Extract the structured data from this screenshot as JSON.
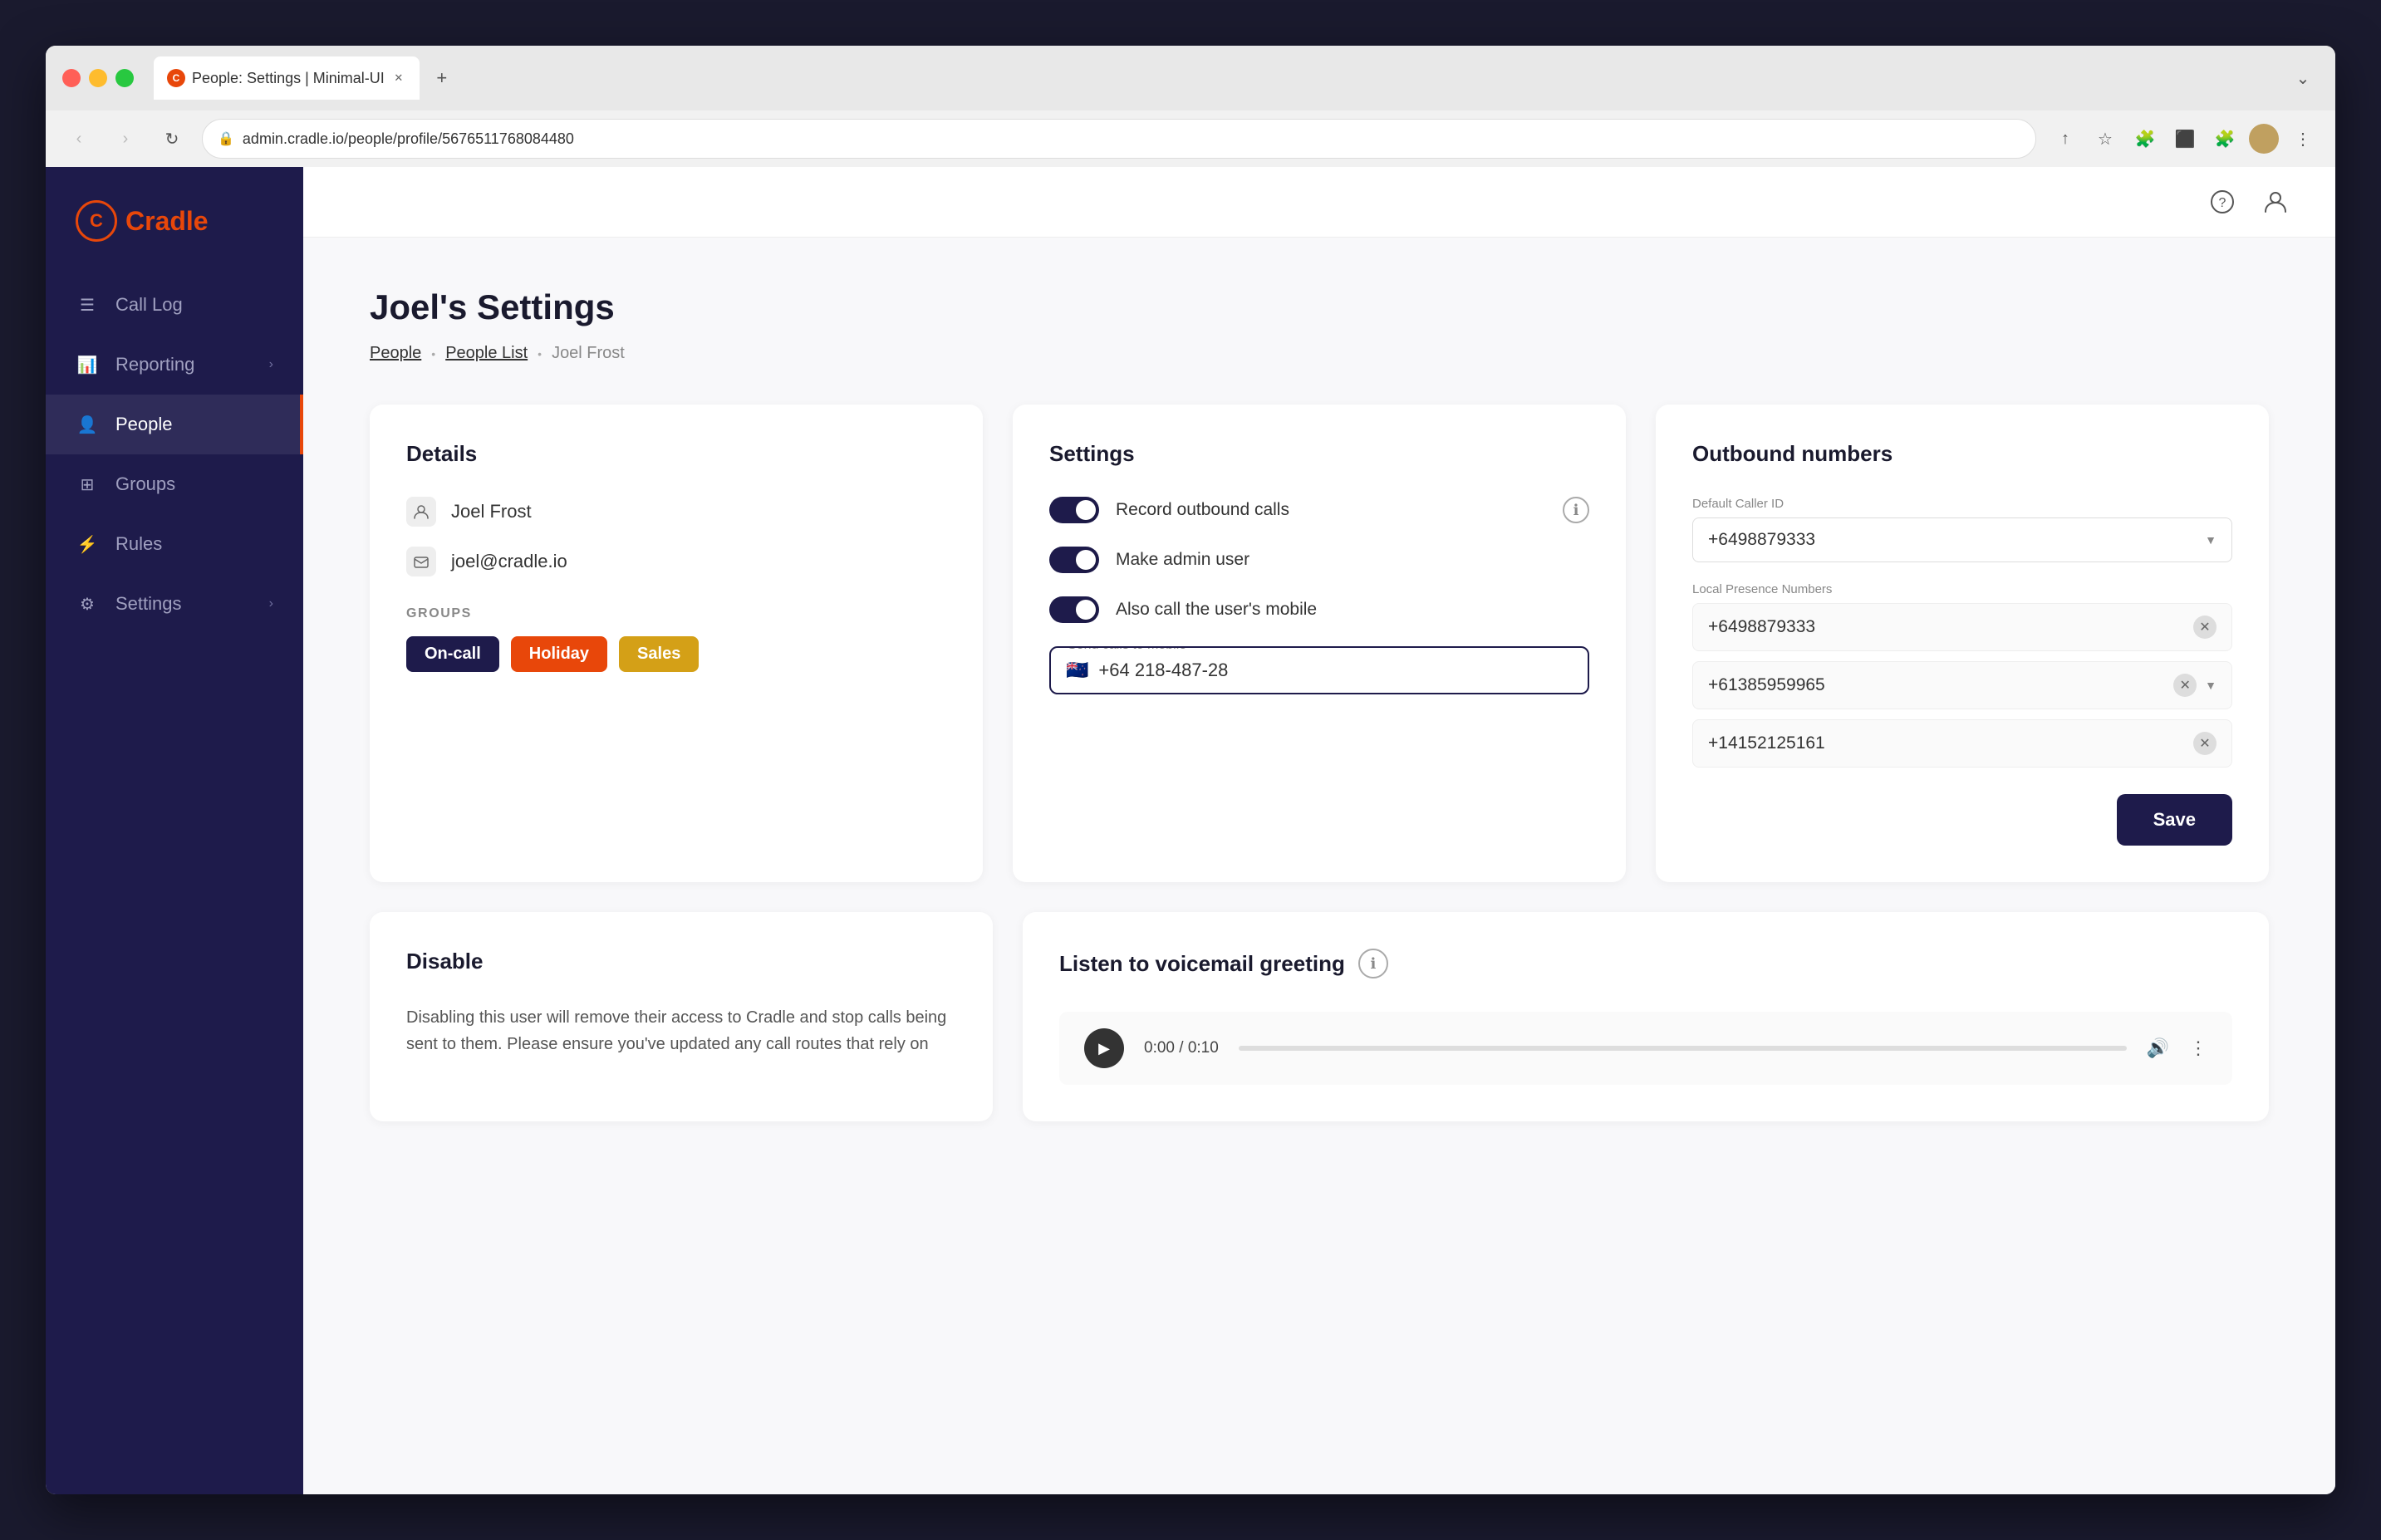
{
  "browser": {
    "tab_title": "People: Settings | Minimal-UI",
    "tab_favicon_letter": "C",
    "url": "admin.cradle.io/people/profile/5676511768084480",
    "new_tab_label": "+"
  },
  "app": {
    "logo_text": "Cradle",
    "logo_letter": "C"
  },
  "sidebar": {
    "items": [
      {
        "id": "call-log",
        "label": "Call Log",
        "has_arrow": false
      },
      {
        "id": "reporting",
        "label": "Reporting",
        "has_arrow": true
      },
      {
        "id": "people",
        "label": "People",
        "has_arrow": false,
        "active": true
      },
      {
        "id": "groups",
        "label": "Groups",
        "has_arrow": false
      },
      {
        "id": "rules",
        "label": "Rules",
        "has_arrow": false
      },
      {
        "id": "settings",
        "label": "Settings",
        "has_arrow": true
      }
    ]
  },
  "page": {
    "title": "Joel's Settings",
    "breadcrumb": {
      "people_label": "People",
      "list_label": "People List",
      "current_label": "Joel Frost"
    }
  },
  "details_card": {
    "title": "Details",
    "person_name": "Joel Frost",
    "person_email": "joel@cradle.io",
    "groups_label": "GROUPS",
    "groups": [
      {
        "id": "oncall",
        "label": "On-call",
        "style": "oncall"
      },
      {
        "id": "holiday",
        "label": "Holiday",
        "style": "holiday"
      },
      {
        "id": "sales",
        "label": "Sales",
        "style": "sales"
      }
    ]
  },
  "settings_card": {
    "title": "Settings",
    "toggles": [
      {
        "id": "record-outbound",
        "label": "Record outbound calls",
        "state": "on",
        "has_info": true
      },
      {
        "id": "make-admin",
        "label": "Make admin user",
        "state": "on",
        "has_info": false
      },
      {
        "id": "call-mobile",
        "label": "Also call the user's mobile",
        "state": "on",
        "has_info": false
      }
    ],
    "mobile_input_label": "Send calls to mobile",
    "mobile_input_value": "+64 218-487-28",
    "mobile_flag": "🇳🇿"
  },
  "outbound_card": {
    "title": "Outbound numbers",
    "default_caller_label": "Default Caller ID",
    "default_caller_value": "+6498879333",
    "local_presence_label": "Local Presence Numbers",
    "numbers": [
      {
        "id": "num1",
        "value": "+6498879333"
      },
      {
        "id": "num2",
        "value": "+61385959965",
        "has_arrow": true
      },
      {
        "id": "num3",
        "value": "+14152125161"
      }
    ],
    "save_label": "Save"
  },
  "disable_card": {
    "title": "Disable",
    "text": "Disabling this user will remove their access to Cradle and stop calls being sent to them. Please ensure you've updated any call routes that rely on"
  },
  "voicemail_card": {
    "title": "Listen to voicemail greeting",
    "time_display": "0:00 / 0:10"
  }
}
